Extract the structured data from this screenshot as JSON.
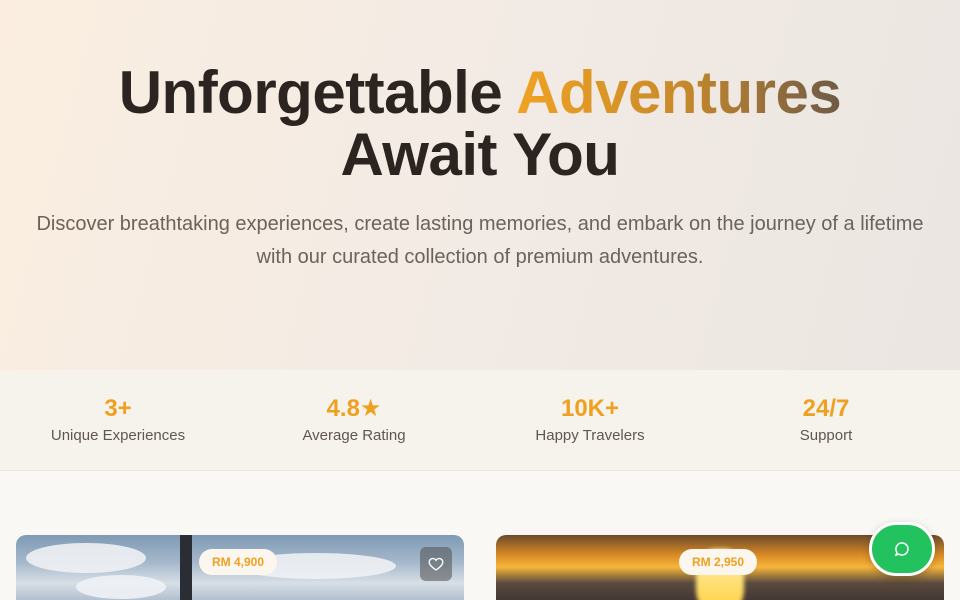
{
  "hero": {
    "title_line1_pre": "Unforgettable ",
    "title_line1_accent": "Adventures",
    "title_line2": "Await You",
    "subtitle": "Discover breathtaking experiences, create lasting memories, and embark on the journey of a lifetime with our curated collection of premium adventures."
  },
  "stats": [
    {
      "value": "3+",
      "label": "Unique Experiences"
    },
    {
      "value": "4.8★",
      "label": "Average Rating"
    },
    {
      "value": "10K+",
      "label": "Happy Travelers"
    },
    {
      "value": "24/7",
      "label": "Support"
    }
  ],
  "cards": [
    {
      "price": "RM 4,900",
      "icon": "heart-icon"
    },
    {
      "price": "RM 2,950"
    }
  ],
  "chat": {
    "icon": "chat-bubble-icon"
  },
  "colors": {
    "accent": "#f0a020",
    "chat": "#22c35e"
  }
}
